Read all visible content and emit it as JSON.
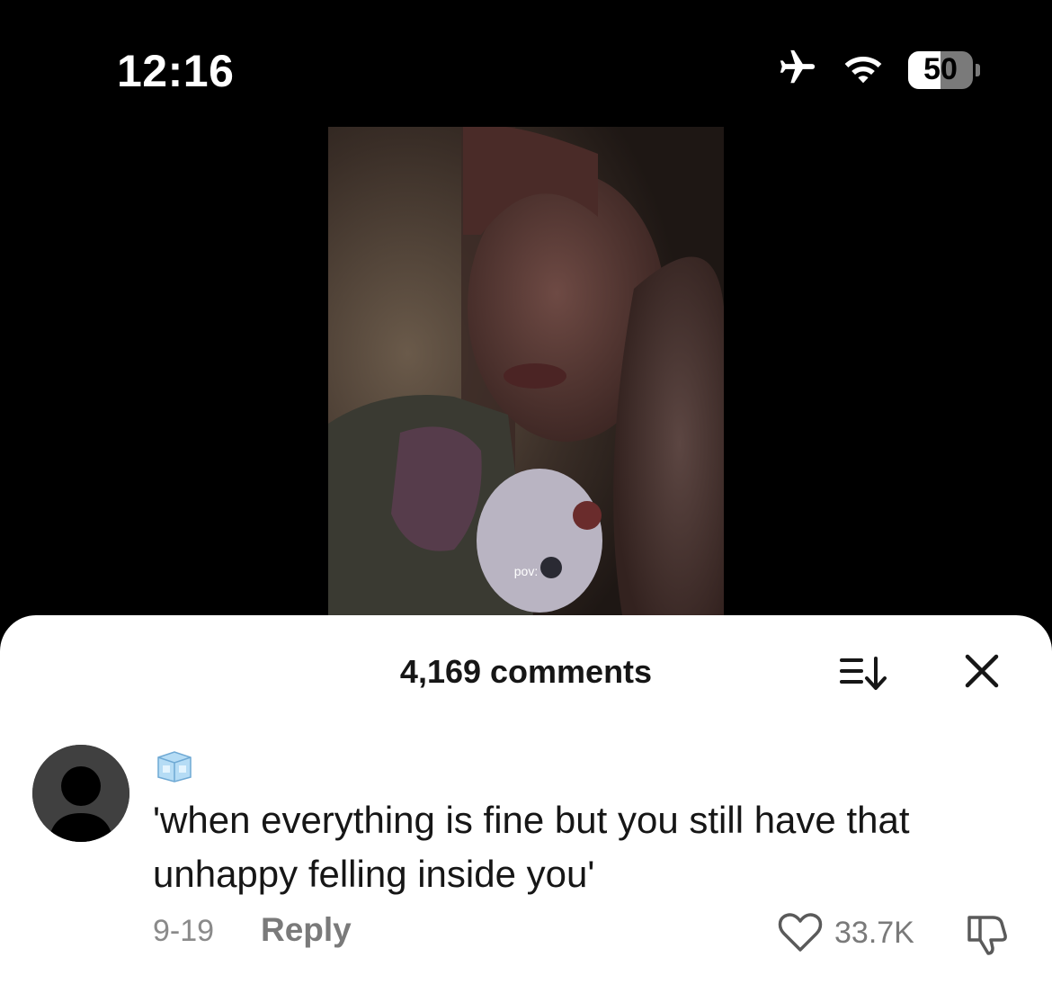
{
  "status_bar": {
    "time": "12:16",
    "battery_level": "50",
    "battery_fraction": 0.5,
    "icons": [
      "airplane-icon",
      "wifi-icon",
      "battery-icon"
    ]
  },
  "video": {
    "caption": "pov:"
  },
  "comments_sheet": {
    "title": "4,169 comments",
    "sort_icon": "sort-icon",
    "close_icon": "close-icon"
  },
  "comment": {
    "username_icon": "ice-cube-icon",
    "text": "'when everything is fine but you still have that unhappy felling inside you'",
    "date": "9-19",
    "reply_label": "Reply",
    "like_count": "33.7K",
    "like_icon": "heart-icon",
    "dislike_icon": "thumbs-down-icon"
  },
  "colors": {
    "background": "#000000",
    "sheet": "#ffffff",
    "text_primary": "#161616",
    "text_secondary": "#8a8a8a"
  }
}
